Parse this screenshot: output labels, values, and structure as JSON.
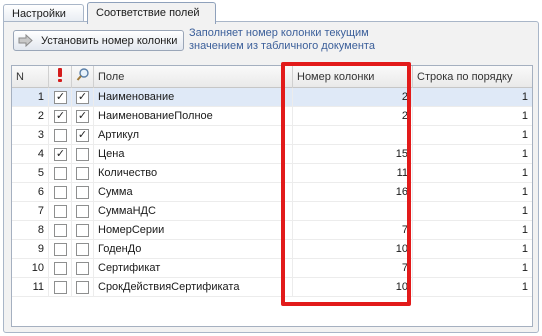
{
  "tabs": [
    "Настройки",
    "Соответствие полей"
  ],
  "toolbar": {
    "set_button": "Установить номер колонки",
    "hint": "Заполняет номер колонки текущим значением из табличного документа"
  },
  "table": {
    "headers": {
      "n": "N",
      "warn_icon": "!",
      "search_icon": "search",
      "field": "Поле",
      "col": "Номер колонки",
      "row": "Строка по порядку"
    },
    "rows": [
      {
        "n": "1",
        "c1": "✓",
        "c2": "✓",
        "field": "Наименование",
        "col": "2",
        "row": "1"
      },
      {
        "n": "2",
        "c1": "✓",
        "c2": "✓",
        "field": "НаименованиеПолное",
        "col": "2",
        "row": "1"
      },
      {
        "n": "3",
        "c1": "",
        "c2": "✓",
        "field": "Артикул",
        "col": "",
        "row": "1"
      },
      {
        "n": "4",
        "c1": "✓",
        "c2": "",
        "field": "Цена",
        "col": "15",
        "row": "1"
      },
      {
        "n": "5",
        "c1": "",
        "c2": "",
        "field": "Количество",
        "col": "11",
        "row": "1"
      },
      {
        "n": "6",
        "c1": "",
        "c2": "",
        "field": "Сумма",
        "col": "16",
        "row": "1"
      },
      {
        "n": "7",
        "c1": "",
        "c2": "",
        "field": "СуммаНДС",
        "col": "",
        "row": "1"
      },
      {
        "n": "8",
        "c1": "",
        "c2": "",
        "field": "НомерСерии",
        "col": "7",
        "row": "1"
      },
      {
        "n": "9",
        "c1": "",
        "c2": "",
        "field": "ГоденДо",
        "col": "10",
        "row": "1"
      },
      {
        "n": "10",
        "c1": "",
        "c2": "",
        "field": "Сертификат",
        "col": "7",
        "row": "1"
      },
      {
        "n": "11",
        "c1": "",
        "c2": "",
        "field": "СрокДействияСертификата",
        "col": "10",
        "row": "1"
      }
    ]
  },
  "colors": {
    "highlight": "#e21a1a",
    "selected_row": "#dfe9f7",
    "hint_text": "#3b5f9a"
  }
}
